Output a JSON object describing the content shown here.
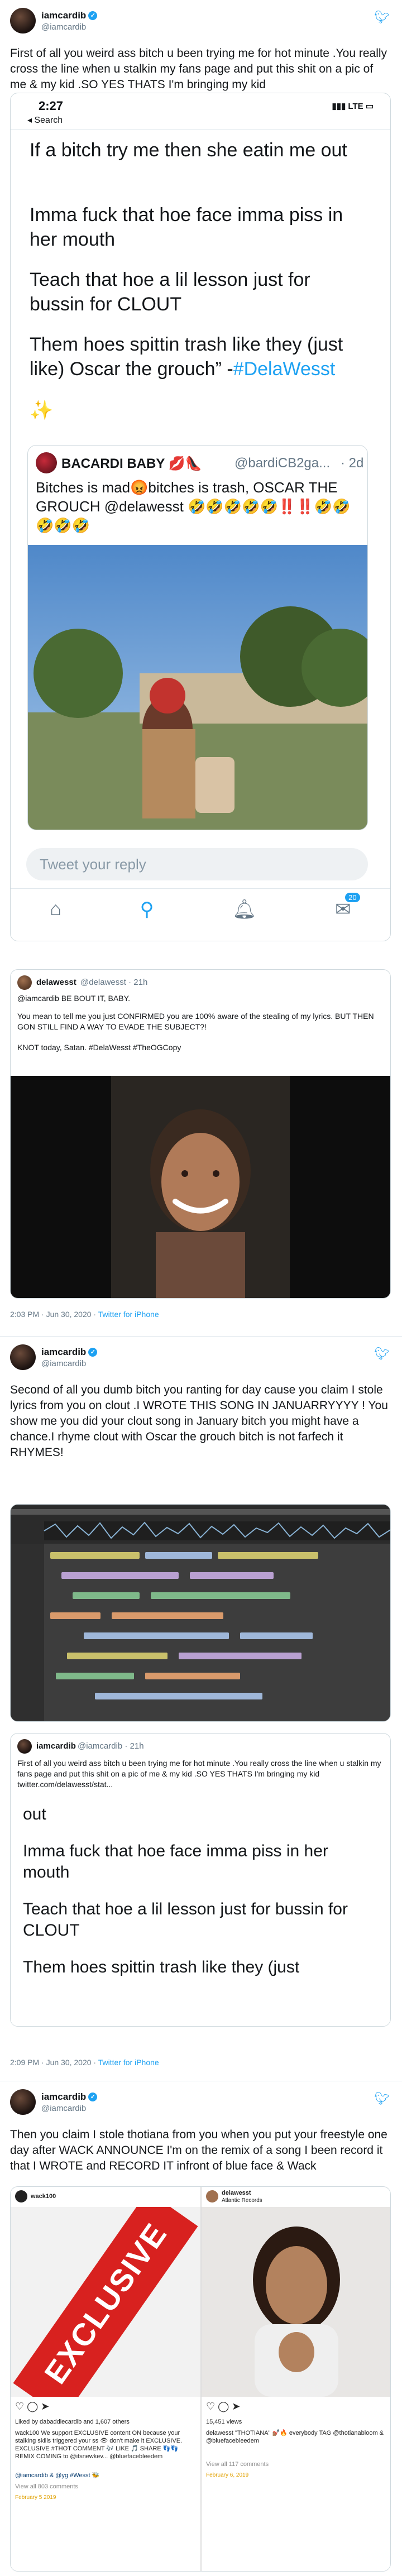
{
  "tweet1": {
    "display_name": "iamcardib",
    "handle": "@iamcardib",
    "text": "First of all you weird ass bitch u been trying me for hot minute .You really cross the line when u stalkin my fans page and put this shit on a pic of me & my kid .SO YES THATS I'm bringing my kid",
    "screenshot": {
      "time": "2:27",
      "back_label": "◂ Search",
      "status_right": "▮▮▮ LTE ▭",
      "lines": [
        "If a bitch try me then she eatin me out",
        "Imma fuck that hoe face imma piss in her mouth",
        "Teach that hoe a lil lesson just for bussin for CLOUT",
        "Them hoes spittin trash like they (just like) Oscar the grouch” -"
      ],
      "hashtag": "#DelaWesst",
      "sparkle": "✨",
      "quote": {
        "name": "BACARDI BABY 💋👠",
        "handle": "@bardiCB2ga...",
        "time": "· 2d",
        "text": "Bitches is mad😡bitches is trash, OSCAR THE GROUCH @delawesst 🤣🤣🤣🤣🤣‼️‼️🤣🤣🤣🤣🤣"
      },
      "reply_placeholder": "Tweet your reply",
      "tab_badge": "20"
    },
    "quoted": {
      "name": "delawesst",
      "handle": "@delawesst · 21h",
      "replying": "@iamcardib BE BOUT IT, BABY.",
      "body1": "You mean to tell me you just CONFIRMED you are 100% aware of the stealing of my lyrics. BUT THEN GON STILL FIND A WAY TO EVADE THE SUBJECT?!",
      "body2": "KNOT today, Satan. #DelaWesst #TheOGCopy"
    },
    "timestamp": "2:03 PM · Jun 30, 2020 · ",
    "source": "Twitter for iPhone"
  },
  "tweet2": {
    "display_name": "iamcardib",
    "handle": "@iamcardib",
    "text": "Second of all you dumb bitch you ranting for day cause you claim I stole lyrics from you on clout .I WROTE THIS SONG IN JANUARRYYYY ! You show me you did your clout song in January bitch you might have a chance.I rhyme clout with Oscar the grouch bitch is not farfech it RHYMES!",
    "quoted": {
      "name": "iamcardib",
      "handle": "@iamcardib · 21h",
      "text": "First of all you weird ass bitch u been trying me for hot minute .You really cross the line when u stalkin my fans page and put this shit on a pic of me & my kid .SO YES THATS I'm bringing my kid twitter.com/delawesst/stat...",
      "lines": [
        "out",
        "Imma fuck that hoe face imma piss in her mouth",
        "Teach that hoe a lil lesson just for bussin for CLOUT",
        "Them hoes spittin trash like they (just"
      ]
    },
    "timestamp": "2:09 PM · Jun 30, 2020 · ",
    "source": "Twitter for iPhone"
  },
  "tweet3": {
    "display_name": "iamcardib",
    "handle": "@iamcardib",
    "text": "Then you claim I stole thotiana from you when you put your freestyle one day after WACK ANNOUNCE I'm on the remix of a song I been record it that I WROTE and RECORD IT infront of blue face & Wack",
    "ig_left": {
      "account": "wack100",
      "exclusive": "EXCLUSIVE",
      "likes": "Liked by dabaddiecardib and 1,607 others",
      "caption": "wack100 We support EXCLUSIVE content ON because your stalking skills triggered your ss 👁 don't make it EXCLUSIVE. EXCLUSIVE #THOT COMMENT 🎶 LIKE 🎵 SHARE 👣👣 REMIX COMING to @itsnewkev... @bluefacebleedem",
      "tags": "@iamcardib & @yg #Wesst 🐝",
      "comments": "View all 803 comments",
      "date": "February 5 2019"
    },
    "ig_right": {
      "account": "delawesst",
      "subtitle": "Atlantic Records",
      "views": "15,451 views",
      "caption": "delawesst \"THOTIANA\" 💅🏽🔥 everybody TAG @thotianabloom & @bluefacebleedem",
      "comments": "View all 117 comments",
      "date": "February 6, 2019"
    }
  }
}
